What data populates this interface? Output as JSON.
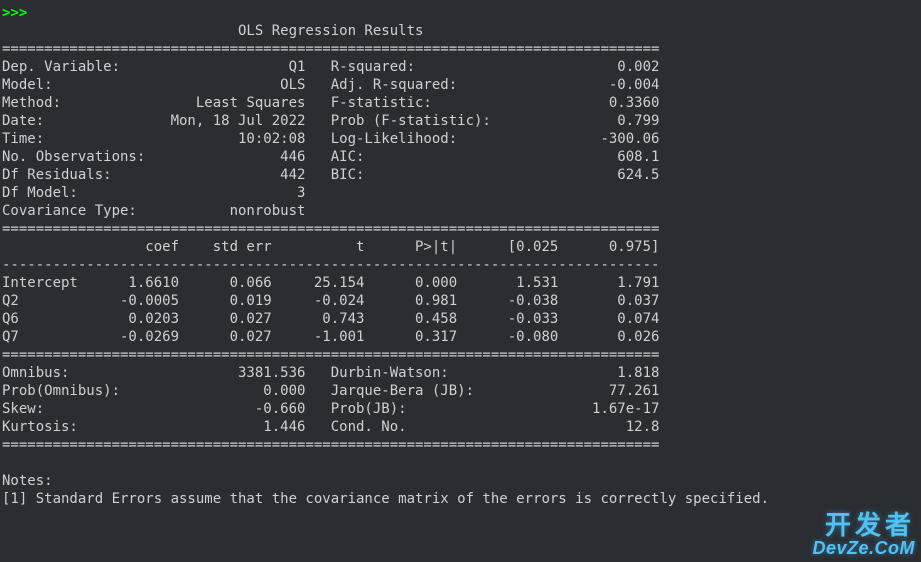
{
  "prompt": ">>>",
  "title_center": "OLS Regression Results",
  "sep_eq": "==============================================================================",
  "top_rows": [
    [
      "Dep. Variable:",
      "Q1",
      "R-squared:",
      "0.002"
    ],
    [
      "Model:",
      "OLS",
      "Adj. R-squared:",
      "-0.004"
    ],
    [
      "Method:",
      "Least Squares",
      "F-statistic:",
      "0.3360"
    ],
    [
      "Date:",
      "Mon, 18 Jul 2022",
      "Prob (F-statistic):",
      "0.799"
    ],
    [
      "Time:",
      "10:02:08",
      "Log-Likelihood:",
      "-300.06"
    ],
    [
      "No. Observations:",
      "446",
      "AIC:",
      "608.1"
    ],
    [
      "Df Residuals:",
      "442",
      "BIC:",
      "624.5"
    ],
    [
      "Df Model:",
      "3",
      "",
      ""
    ],
    [
      "Covariance Type:",
      "nonrobust",
      "",
      ""
    ]
  ],
  "coef_header_line": "                 coef    std err          t      P>|t|      [0.025      0.975]",
  "sep_dash": "------------------------------------------------------------------------------",
  "coef_rows": [
    {
      "name": "Intercept",
      "coef": "1.6610",
      "se": "0.066",
      "t": "25.154",
      "p": "0.000",
      "lo": "1.531",
      "hi": "1.791"
    },
    {
      "name": "Q2",
      "coef": "-0.0005",
      "se": "0.019",
      "t": "-0.024",
      "p": "0.981",
      "lo": "-0.038",
      "hi": "0.037"
    },
    {
      "name": "Q6",
      "coef": "0.0203",
      "se": "0.027",
      "t": "0.743",
      "p": "0.458",
      "lo": "-0.033",
      "hi": "0.074"
    },
    {
      "name": "Q7",
      "coef": "-0.0269",
      "se": "0.027",
      "t": "-1.001",
      "p": "0.317",
      "lo": "-0.080",
      "hi": "0.026"
    }
  ],
  "bottom_rows": [
    [
      "Omnibus:",
      "3381.536",
      "Durbin-Watson:",
      "1.818"
    ],
    [
      "Prob(Omnibus):",
      "0.000",
      "Jarque-Bera (JB):",
      "77.261"
    ],
    [
      "Skew:",
      "-0.660",
      "Prob(JB):",
      "1.67e-17"
    ],
    [
      "Kurtosis:",
      "1.446",
      "Cond. No.",
      "12.8"
    ]
  ],
  "notes_label": "Notes:",
  "notes_1": "[1] Standard Errors assume that the covariance matrix of the errors is correctly specified.",
  "watermark_cn": "开发者",
  "watermark_en": "DevZe.CoM"
}
